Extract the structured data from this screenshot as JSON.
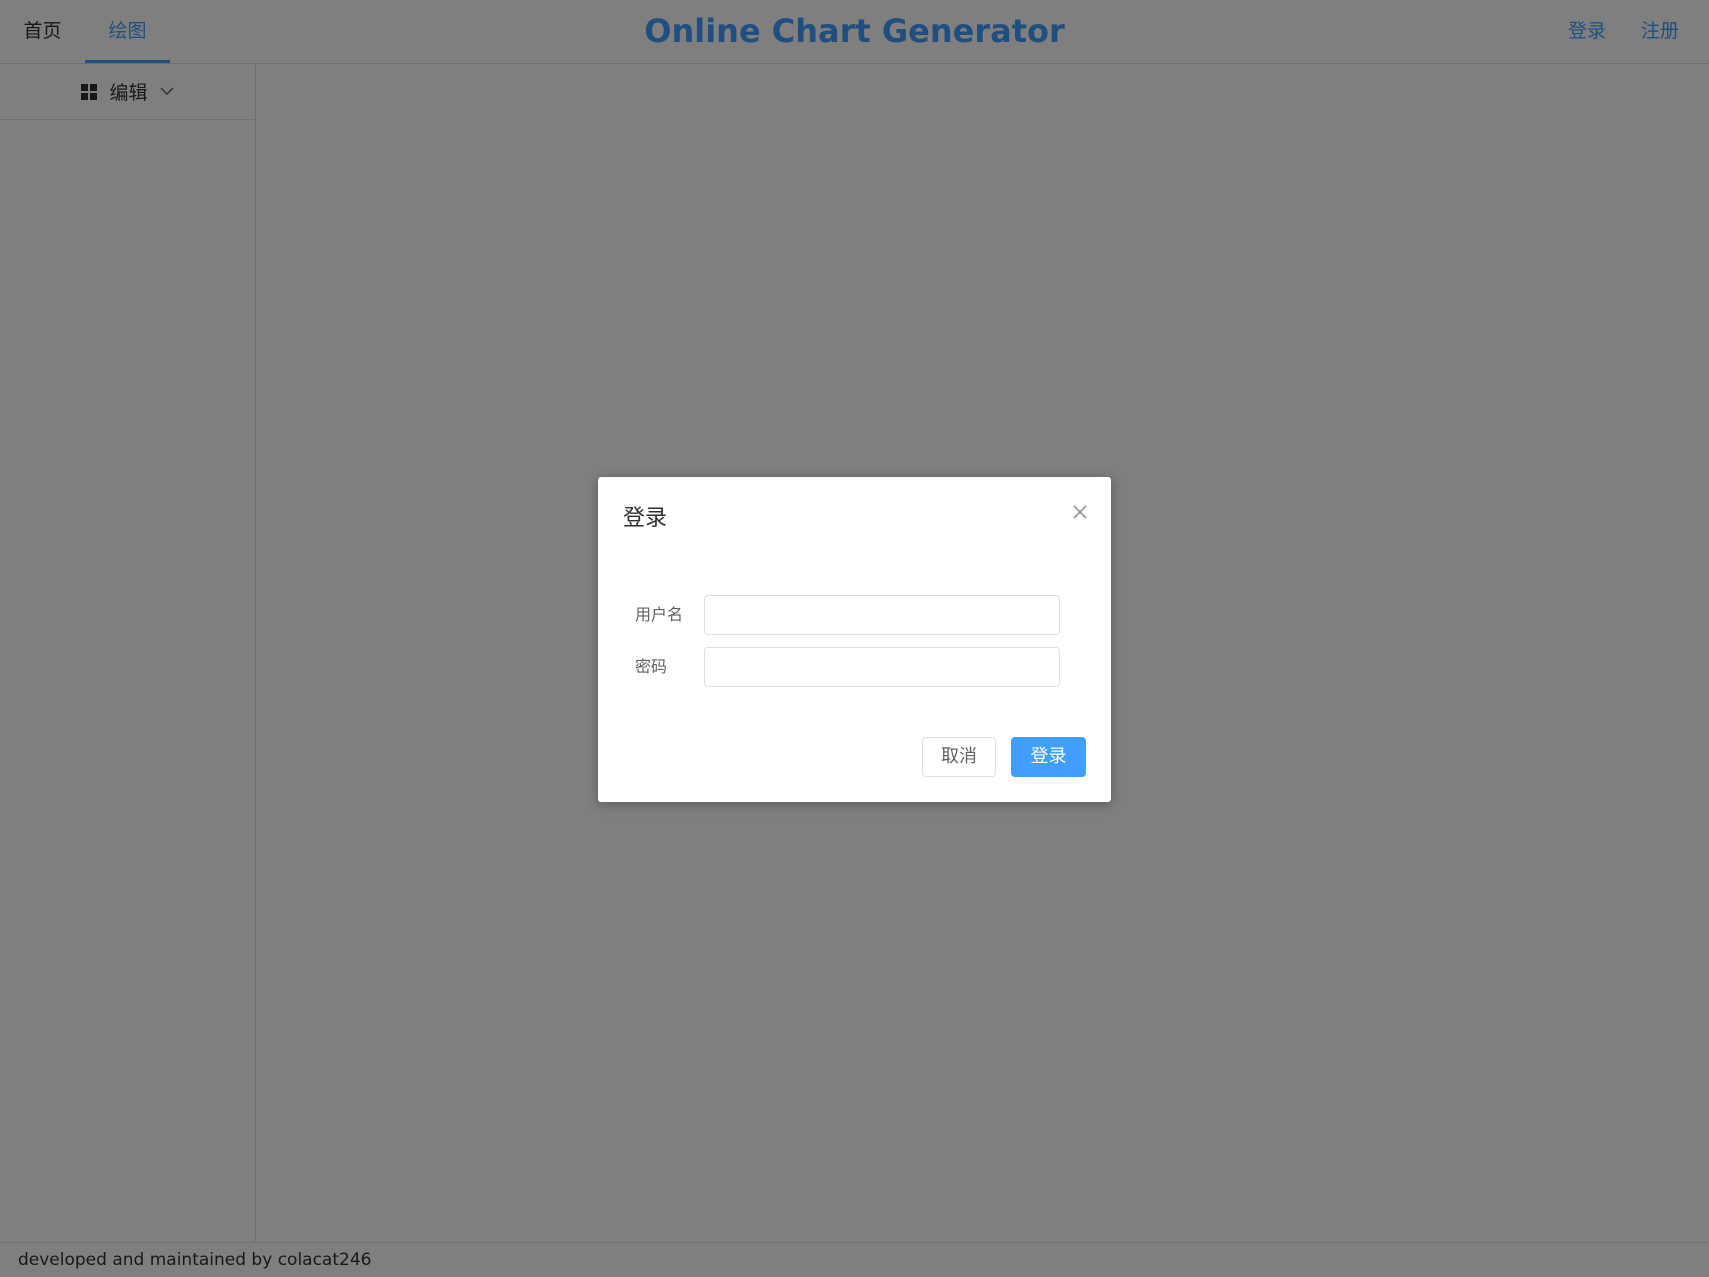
{
  "header": {
    "tabs": [
      {
        "label": "首页"
      },
      {
        "label": "绘图"
      }
    ],
    "brand": "Online Chart Generator",
    "login_label": "登录",
    "register_label": "注册"
  },
  "sidebar": {
    "menu_label": "编辑"
  },
  "footer": {
    "text": "developed and maintained by colacat246"
  },
  "dialog": {
    "title": "登录",
    "username_label": "用户名",
    "username_value": "",
    "password_label": "密码",
    "password_value": "",
    "cancel_label": "取消",
    "confirm_label": "登录"
  },
  "colors": {
    "accent": "#409eff",
    "overlay": "rgba(0,0,0,0.5)"
  }
}
